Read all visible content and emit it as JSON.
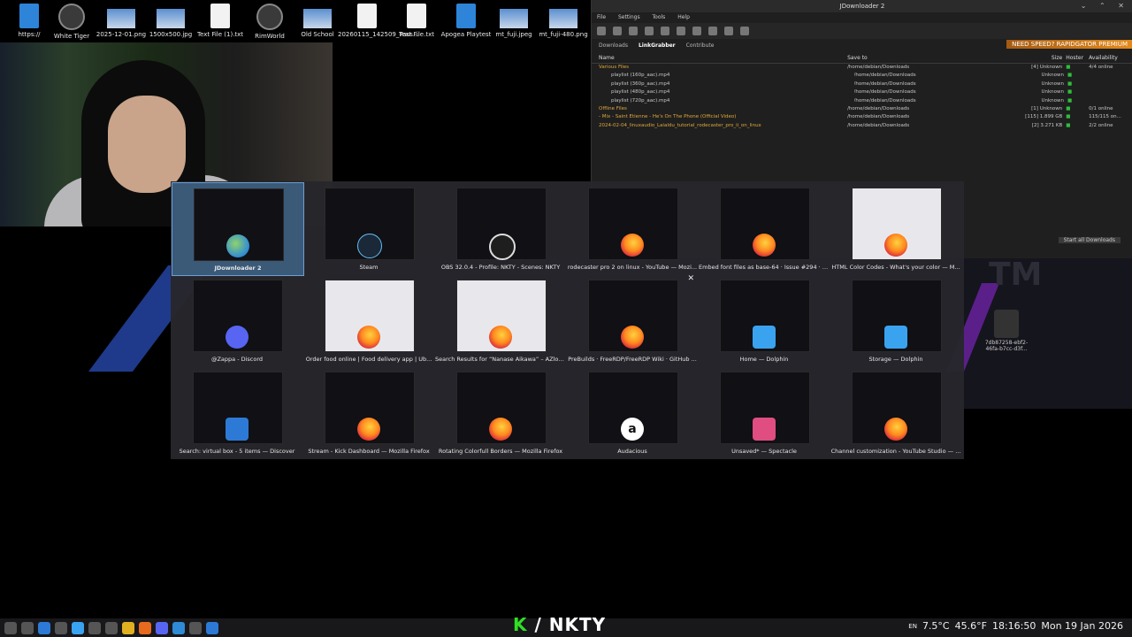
{
  "desktop_icons": [
    {
      "label": "https://",
      "icon": "link-icon"
    },
    {
      "label": "White Tiger",
      "icon": "tiger-icon"
    },
    {
      "label": "2025-12-01.png",
      "icon": "image-file-icon"
    },
    {
      "label": "1500x500.jpg",
      "icon": "image-file-icon"
    },
    {
      "label": "Text File (1).txt",
      "icon": "text-file-icon"
    },
    {
      "label": "RimWorld",
      "icon": "rimworld-icon"
    },
    {
      "label": "Old School",
      "icon": "old-school-icon"
    },
    {
      "label": "20260115_142509_Pass...",
      "icon": "file-icon"
    },
    {
      "label": "Text File.txt",
      "icon": "text-file-icon"
    },
    {
      "label": "Apogea Playtest",
      "icon": "apogea-icon"
    },
    {
      "label": "mt_fuji.jpeg",
      "icon": "image-file-icon"
    },
    {
      "label": "mt_fuji-480.png",
      "icon": "image-file-icon"
    }
  ],
  "jdownloader": {
    "title": "JDownloader 2",
    "menu": [
      "File",
      "Settings",
      "Tools",
      "Help"
    ],
    "tabs": [
      "Downloads",
      "LinkGrabber",
      "Contribute"
    ],
    "active_tab": "LinkGrabber",
    "premium_banner": "NEED SPEED? RAPIDGATOR PREMIUM",
    "columns": [
      "Name",
      "Save to",
      "Size",
      "Hoster",
      "Availability"
    ],
    "rows": [
      {
        "name": "Various Files",
        "save": "/home/debian/Downloads",
        "count": "[4]",
        "size": "Unknown",
        "avail": "4/4 online",
        "pkg": true
      },
      {
        "name": "playlist (160p_aac).mp4",
        "save": "/home/debian/Downloads",
        "count": "",
        "size": "Unknown",
        "avail": "",
        "pkg": false
      },
      {
        "name": "playlist (360p_aac).mp4",
        "save": "/home/debian/Downloads",
        "count": "",
        "size": "Unknown",
        "avail": "",
        "pkg": false
      },
      {
        "name": "playlist (480p_aac).mp4",
        "save": "/home/debian/Downloads",
        "count": "",
        "size": "Unknown",
        "avail": "",
        "pkg": false
      },
      {
        "name": "playlist (720p_aac).mp4",
        "save": "/home/debian/Downloads",
        "count": "",
        "size": "Unknown",
        "avail": "",
        "pkg": false
      },
      {
        "name": "Offline Files",
        "save": "/home/debian/Downloads",
        "count": "[1]",
        "size": "Unknown",
        "avail": "0/1 online",
        "pkg": true
      },
      {
        "name": "- Mix - Saint Etienne - He's On The Phone (Official Video)",
        "save": "/home/debian/Downloads",
        "count": "[115]",
        "size": "1.899 GB",
        "avail": "115/115 on...",
        "pkg": true
      },
      {
        "name": "2024-02-04_linuxaudio_Laialdu_tutorial_rodecaster_pro_ii_on_linux",
        "save": "/home/debian/Downloads",
        "count": "[2]",
        "size": "3.271 KB",
        "avail": "2/2 online",
        "pkg": true
      }
    ],
    "start_all": "Start all Downloads"
  },
  "switcher": {
    "windows": [
      {
        "label": "JDownloader 2",
        "app": "jdownloader-icon",
        "selected": true
      },
      {
        "label": "Steam",
        "app": "steam-icon"
      },
      {
        "label": "OBS 32.0.4 - Profile: NKTY - Scenes: NKTY",
        "app": "obs-icon"
      },
      {
        "label": "rodecaster pro 2 on linux - YouTube — Mozi...",
        "app": "firefox-icon"
      },
      {
        "label": "Embed font files as base-64 · Issue #294 · F...",
        "app": "firefox-icon"
      },
      {
        "label": "HTML Color Codes - What's your color — M...",
        "app": "firefox-icon"
      },
      {
        "label": "@Zappa - Discord",
        "app": "discord-icon"
      },
      {
        "label": "Order food online | Food delivery app | Ub...",
        "app": "firefox-icon"
      },
      {
        "label": "Search Results for “Nanase Aikawa” – AZlop...",
        "app": "firefox-icon"
      },
      {
        "label": "PreBuilds · FreeRDP/FreeRDP Wiki · GitHub ...",
        "app": "firefox-icon"
      },
      {
        "label": "Home — Dolphin",
        "app": "dolphin-icon"
      },
      {
        "label": "Storage — Dolphin",
        "app": "dolphin-icon"
      },
      {
        "label": "Search: virtual box - 5 items — Discover",
        "app": "discover-icon"
      },
      {
        "label": "Stream - Kick Dashboard — Mozilla Firefox",
        "app": "firefox-icon"
      },
      {
        "label": "Rotating Colorfull Borders — Mozilla Firefox",
        "app": "firefox-icon"
      },
      {
        "label": "Audacious",
        "app": "audacious-icon"
      },
      {
        "label": "Unsaved* — Spectacle",
        "app": "spectacle-icon"
      },
      {
        "label": "Channel customization - YouTube Studio — ...",
        "app": "firefox-icon"
      }
    ]
  },
  "side_item": {
    "label": "7db87258-ebf2-46fa-b7cc-d3f..."
  },
  "brand": {
    "k": "K",
    "slash": "/",
    "name": "NKTY"
  },
  "tray": {
    "lang": "EN",
    "temp": "7.5°C",
    "temp2": "45.6°F",
    "time": "18:16:50",
    "date": "Mon 19 Jan 2026"
  }
}
